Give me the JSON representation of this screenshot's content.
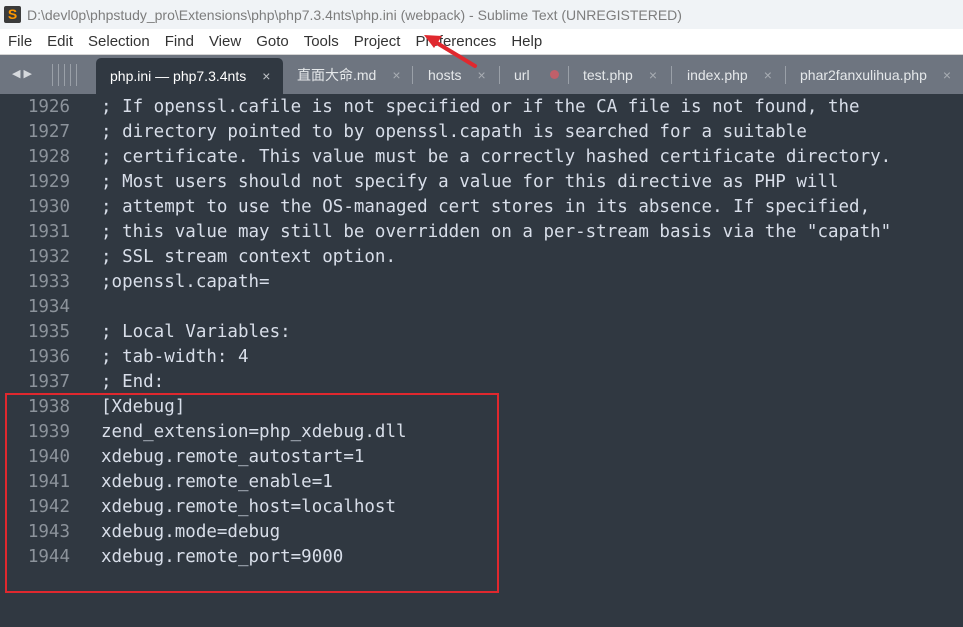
{
  "window": {
    "title": "D:\\devl0p\\phpstudy_pro\\Extensions\\php\\php7.3.4nts\\php.ini (webpack) - Sublime Text (UNREGISTERED)",
    "app_icon": "sublime-text-logo"
  },
  "menu": {
    "items": [
      "File",
      "Edit",
      "Selection",
      "Find",
      "View",
      "Goto",
      "Tools",
      "Project",
      "Preferences",
      "Help"
    ]
  },
  "tabs": {
    "nav_icons": [
      "arrow-left-icon",
      "arrow-right-icon"
    ],
    "items": [
      {
        "label": "php.ini — php7.3.4nts",
        "active": true,
        "state": "close"
      },
      {
        "label": "直面大命.md",
        "active": false,
        "state": "close"
      },
      {
        "label": "hosts",
        "active": false,
        "state": "close"
      },
      {
        "label": "url",
        "active": false,
        "state": "dirty"
      },
      {
        "label": "test.php",
        "active": false,
        "state": "close"
      },
      {
        "label": "index.php",
        "active": false,
        "state": "close"
      },
      {
        "label": "phar2fanxulihua.php",
        "active": false,
        "state": "close"
      }
    ],
    "close_glyph": "×"
  },
  "editor": {
    "lines": [
      {
        "n": "1926",
        "text": "; If openssl.cafile is not specified or if the CA file is not found, the"
      },
      {
        "n": "1927",
        "text": "; directory pointed to by openssl.capath is searched for a suitable"
      },
      {
        "n": "1928",
        "text": "; certificate. This value must be a correctly hashed certificate directory."
      },
      {
        "n": "1929",
        "text": "; Most users should not specify a value for this directive as PHP will"
      },
      {
        "n": "1930",
        "text": "; attempt to use the OS-managed cert stores in its absence. If specified,"
      },
      {
        "n": "1931",
        "text": "; this value may still be overridden on a per-stream basis via the \"capath\""
      },
      {
        "n": "1932",
        "text": "; SSL stream context option."
      },
      {
        "n": "1933",
        "text": ";openssl.capath="
      },
      {
        "n": "1934",
        "text": ""
      },
      {
        "n": "1935",
        "text": "; Local Variables:"
      },
      {
        "n": "1936",
        "text": "; tab-width: 4"
      },
      {
        "n": "1937",
        "text": "; End:"
      },
      {
        "n": "1938",
        "text": "[Xdebug]"
      },
      {
        "n": "1939",
        "text": "zend_extension=php_xdebug.dll"
      },
      {
        "n": "1940",
        "text": "xdebug.remote_autostart=1"
      },
      {
        "n": "1941",
        "text": "xdebug.remote_enable=1"
      },
      {
        "n": "1942",
        "text": "xdebug.remote_host=localhost"
      },
      {
        "n": "1943",
        "text": "xdebug.mode=debug"
      },
      {
        "n": "1944",
        "text": "xdebug.remote_port=9000"
      }
    ]
  },
  "annotations": {
    "highlight_box_color": "#e0282e",
    "arrow_color": "#e0282e",
    "arrow_target": "Project"
  }
}
